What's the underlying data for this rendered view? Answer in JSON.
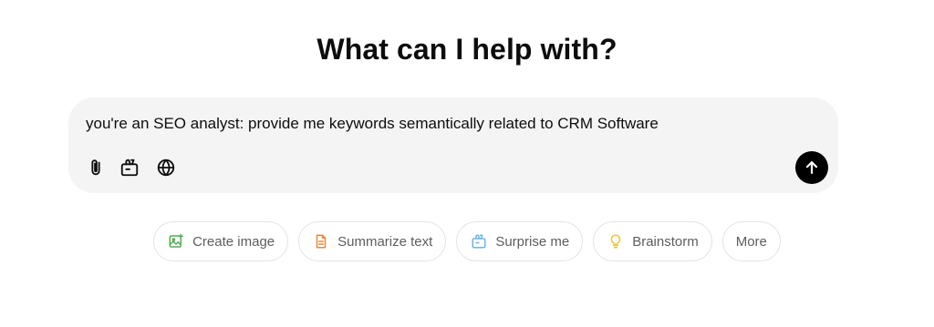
{
  "heading": "What can I help with?",
  "composer": {
    "prompt_value": "you're an SEO analyst: provide me keywords semantically related to CRM Software",
    "tools": [
      {
        "name": "attach",
        "icon": "paperclip-icon"
      },
      {
        "name": "tools",
        "icon": "toolbox-icon"
      },
      {
        "name": "search-web",
        "icon": "globe-icon"
      }
    ],
    "send_icon": "arrow-up-icon"
  },
  "suggestions": [
    {
      "label": "Create image",
      "icon": "image-icon",
      "color": "#4caf50"
    },
    {
      "label": "Summarize text",
      "icon": "document-icon",
      "color": "#e8893c"
    },
    {
      "label": "Surprise me",
      "icon": "gift-icon",
      "color": "#6ab7e8"
    },
    {
      "label": "Brainstorm",
      "icon": "lightbulb-icon",
      "color": "#e8c53a"
    },
    {
      "label": "More",
      "icon": "",
      "color": ""
    }
  ]
}
